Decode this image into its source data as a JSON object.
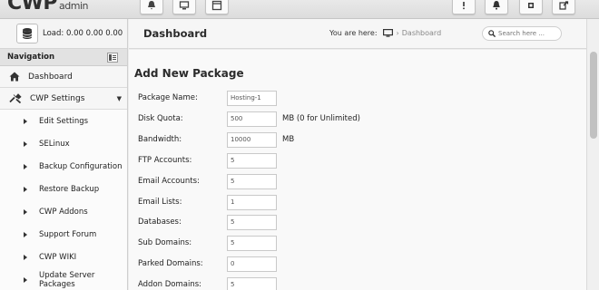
{
  "brand": {
    "logo": "CWP",
    "logo_sub": "admin"
  },
  "topbar": {
    "left_icons": [
      "bell-icon",
      "desktop-icon",
      "window-icon"
    ],
    "right_icons": [
      "help-icon",
      "alerts-icon",
      "user-icon",
      "logout-icon"
    ]
  },
  "sidebar": {
    "load_text": "Load: 0.00  0.00  0.00",
    "nav_title": "Navigation",
    "dashboard": "Dashboard",
    "cwp_settings": "CWP Settings",
    "items": [
      {
        "label": "Edit Settings"
      },
      {
        "label": "SELinux"
      },
      {
        "label": "Backup Configuration"
      },
      {
        "label": "Restore Backup"
      },
      {
        "label": "CWP Addons"
      },
      {
        "label": "Support Forum"
      },
      {
        "label": "CWP WIKI"
      },
      {
        "label": "Update Server Packages"
      }
    ]
  },
  "header": {
    "title": "Dashboard",
    "breadcrumb_prefix": "You are here:",
    "breadcrumb_current": "Dashboard",
    "search_placeholder": "Search here ..."
  },
  "form": {
    "title": "Add New Package",
    "fields": [
      {
        "label": "Package Name:",
        "value": "Hosting-1",
        "unit": ""
      },
      {
        "label": "Disk Quota:",
        "value": "500",
        "unit": "MB (0 for Unlimited)"
      },
      {
        "label": "Bandwidth:",
        "value": "10000",
        "unit": "MB"
      },
      {
        "label": "FTP Accounts:",
        "value": "5",
        "unit": ""
      },
      {
        "label": "Email Accounts:",
        "value": "5",
        "unit": ""
      },
      {
        "label": "Email Lists:",
        "value": "1",
        "unit": ""
      },
      {
        "label": "Databases:",
        "value": "5",
        "unit": ""
      },
      {
        "label": "Sub Domains:",
        "value": "5",
        "unit": ""
      },
      {
        "label": "Parked Domains:",
        "value": "0",
        "unit": ""
      },
      {
        "label": "Addon Domains:",
        "value": "5",
        "unit": ""
      }
    ]
  }
}
